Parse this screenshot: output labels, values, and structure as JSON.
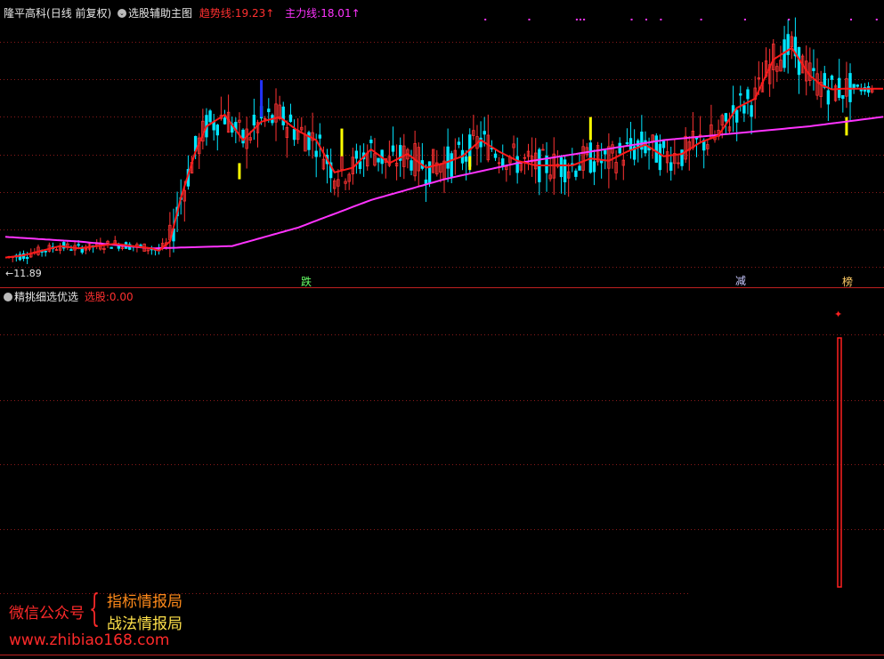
{
  "top_panel": {
    "stock_title": "隆平高科",
    "period": "(日线 前复权)",
    "indicator_name": "选股辅助主图",
    "trend_label": "趋势线:",
    "trend_value": "19.23",
    "trend_arrow": "↑",
    "main_label": "主力线:",
    "main_value": "18.01",
    "main_arrow": "↑",
    "low_price_label": "←11.89",
    "markers": [
      "跌",
      "减",
      "榜"
    ]
  },
  "bottom_panel": {
    "indicator_name": "精挑细选优选",
    "pick_label": "选股:",
    "pick_value": "0.00"
  },
  "watermark": {
    "wechat": "微信公众号",
    "brace": "{",
    "line1": "指标情报局",
    "line2": "战法情报局",
    "url": "www.zhibiao168.com"
  },
  "colors": {
    "background": "#000000",
    "grid": "#8b1a1a",
    "up_candle": "#ff3333",
    "down_candle": "#00e5ff",
    "trend_line": "#ff1a1a",
    "main_line": "#ff33ff",
    "yellow_bar": "#ffff00",
    "blue_bar": "#2233ff",
    "signal_bar": "#ff2020"
  },
  "chart_data": [
    {
      "type": "line",
      "title": "",
      "series": [
        {
          "name": "趋势线",
          "x": [
            0,
            5,
            10,
            15,
            20,
            25,
            30,
            35,
            40,
            42,
            45,
            48,
            52,
            55,
            60,
            65,
            70,
            75,
            80,
            85,
            90,
            95,
            100,
            105,
            110,
            115,
            120,
            125,
            130,
            135,
            140,
            145,
            150,
            155,
            160,
            165,
            170,
            175,
            180,
            185,
            190,
            195,
            200,
            205,
            210,
            215,
            220,
            223,
            226,
            229,
            232,
            235,
            238,
            240
          ],
          "values": [
            11.9,
            12.0,
            12.2,
            12.4,
            12.3,
            12.4,
            12.5,
            12.4,
            12.3,
            12.2,
            12.6,
            14.5,
            16.5,
            17.6,
            18.1,
            17.0,
            17.8,
            18.0,
            17.4,
            17.0,
            15.6,
            15.8,
            16.6,
            16.0,
            16.4,
            15.8,
            16.0,
            16.3,
            17.0,
            16.5,
            16.1,
            15.9,
            15.9,
            15.9,
            16.2,
            16.1,
            16.5,
            16.8,
            16.3,
            16.4,
            16.9,
            17.2,
            18.4,
            18.8,
            20.5,
            21.0,
            19.8,
            19.4,
            19.2,
            19.23,
            19.23,
            19.23,
            19.23,
            19.23
          ]
        },
        {
          "name": "主力线",
          "x": [
            0,
            20,
            40,
            62,
            80,
            100,
            120,
            140,
            160,
            180,
            200,
            220,
            240
          ],
          "values": [
            12.8,
            12.6,
            12.3,
            12.4,
            13.2,
            14.4,
            15.3,
            16.0,
            16.5,
            17.0,
            17.3,
            17.6,
            18.01
          ]
        }
      ],
      "annotations": [
        "←11.89",
        "跌",
        "减",
        "榜"
      ]
    },
    {
      "type": "bar",
      "title": "",
      "series": [
        {
          "name": "选股",
          "x": [
            230
          ],
          "values": [
            1
          ]
        }
      ],
      "annotations": [
        "选股: 0.00"
      ]
    }
  ]
}
